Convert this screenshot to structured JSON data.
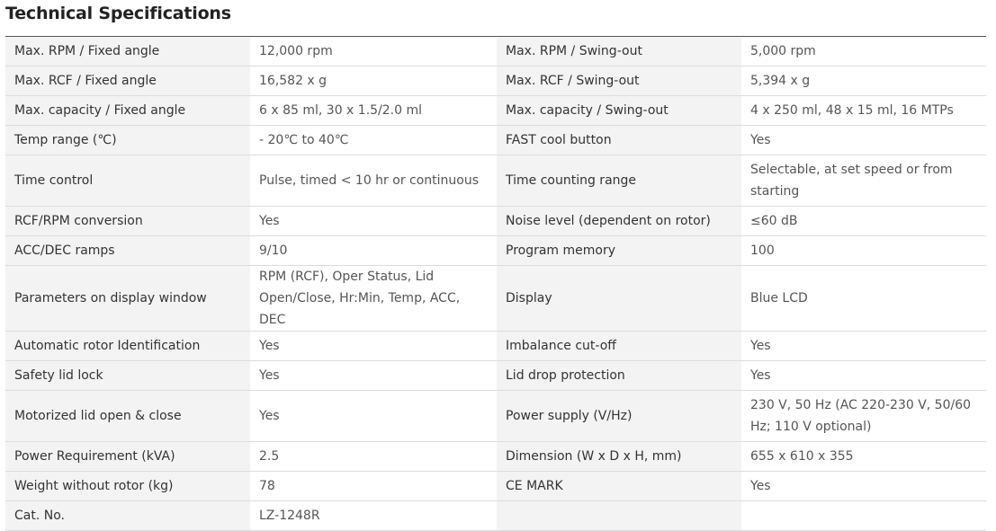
{
  "title": "Technical Specifications",
  "rows": [
    {
      "l1": "Max. RPM / Fixed angle",
      "v1": "12,000 rpm",
      "l2": "Max. RPM / Swing-out",
      "v2": "5,000 rpm"
    },
    {
      "l1": "Max. RCF / Fixed angle",
      "v1": "16,582 x g",
      "l2": "Max. RCF / Swing-out",
      "v2": "5,394 x g"
    },
    {
      "l1": "Max. capacity / Fixed angle",
      "v1": "6 x 85 ml, 30 x 1.5/2.0 ml",
      "l2": "Max. capacity / Swing-out",
      "v2": "4 x 250 ml, 48 x 15 ml, 16 MTPs"
    },
    {
      "l1": "Temp range (℃)",
      "v1": "- 20℃ to 40℃",
      "l2": "FAST cool button",
      "v2": "Yes"
    },
    {
      "l1": "Time control",
      "v1": "Pulse, timed < 10 hr or continuous",
      "l2": "Time counting range",
      "v2": "Selectable, at set speed or from starting"
    },
    {
      "l1": "RCF/RPM conversion",
      "v1": "Yes",
      "l2": "Noise level (dependent on rotor)",
      "v2": "≤60 dB"
    },
    {
      "l1": "ACC/DEC ramps",
      "v1": "9/10",
      "l2": "Program memory",
      "v2": "100"
    },
    {
      "l1": "Parameters on display window",
      "v1": "RPM (RCF), Oper Status, Lid Open/Close, Hr:Min, Temp, ACC, DEC",
      "l2": "Display",
      "v2": "Blue LCD"
    },
    {
      "l1": "Automatic rotor Identification",
      "v1": "Yes",
      "l2": "Imbalance cut-off",
      "v2": "Yes"
    },
    {
      "l1": "Safety lid lock",
      "v1": "Yes",
      "l2": "Lid drop protection",
      "v2": "Yes"
    },
    {
      "l1": "Motorized lid open & close",
      "v1": "Yes",
      "l2": "Power supply (V/Hz)",
      "v2": "230 V, 50 Hz (AC 220-230 V, 50/60 Hz; 110 V optional)"
    },
    {
      "l1": "Power Requirement (kVA)",
      "v1": "2.5",
      "l2": "Dimension (W x D x H, mm)",
      "v2": "655 x 610 x 355"
    },
    {
      "l1": "Weight without rotor (kg)",
      "v1": "78",
      "l2": "CE MARK",
      "v2": "Yes"
    },
    {
      "l1": "Cat. No.",
      "v1": "LZ-1248R",
      "l2": "",
      "v2": ""
    }
  ]
}
